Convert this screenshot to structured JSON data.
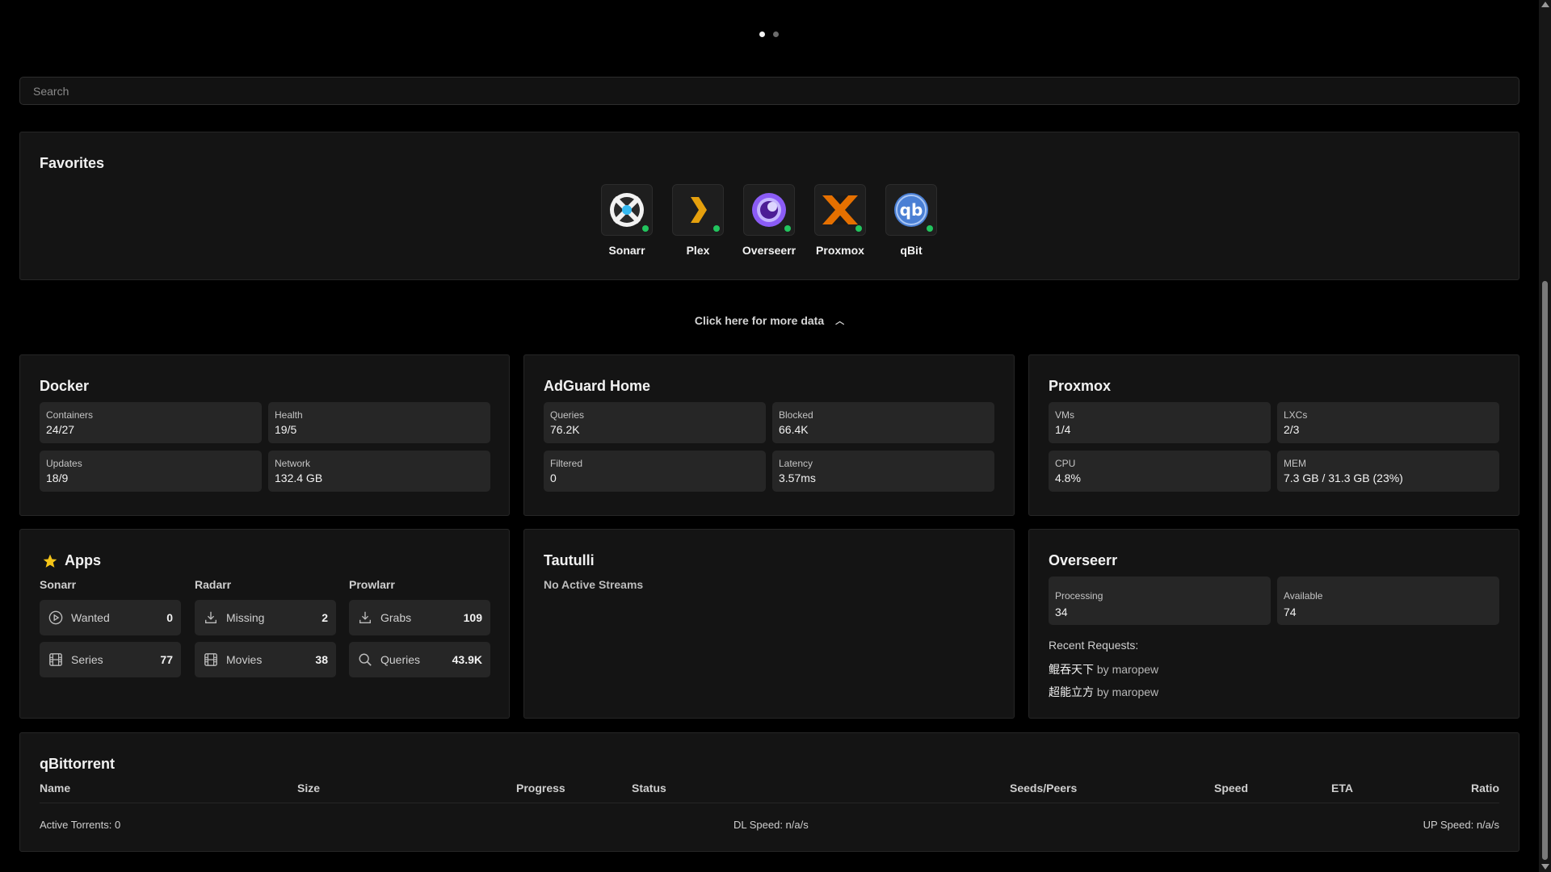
{
  "pager": {
    "active_index": 0,
    "count": 2
  },
  "search": {
    "placeholder": "Search"
  },
  "favorites": {
    "title": "Favorites",
    "items": [
      {
        "label": "Sonarr",
        "icon": "sonarr-icon",
        "status_color": "#22c55e"
      },
      {
        "label": "Plex",
        "icon": "plex-icon",
        "status_color": "#22c55e"
      },
      {
        "label": "Overseerr",
        "icon": "overseerr-icon",
        "status_color": "#22c55e"
      },
      {
        "label": "Proxmox",
        "icon": "proxmox-icon",
        "status_color": "#22c55e"
      },
      {
        "label": "qBit",
        "icon": "qbittorrent-icon",
        "status_color": "#22c55e"
      }
    ]
  },
  "more_data": {
    "label": "Click here for more data",
    "icon": "chevron-up-icon"
  },
  "docker": {
    "title": "Docker",
    "stats": [
      {
        "label": "Containers",
        "value": "24/27"
      },
      {
        "label": "Health",
        "value": "19/5"
      },
      {
        "label": "Updates",
        "value": "18/9"
      },
      {
        "label": "Network",
        "value": "132.4 GB"
      }
    ]
  },
  "adguard": {
    "title": "AdGuard Home",
    "stats": [
      {
        "label": "Queries",
        "value": "76.2K"
      },
      {
        "label": "Blocked",
        "value": "66.4K"
      },
      {
        "label": "Filtered",
        "value": "0"
      },
      {
        "label": "Latency",
        "value": "3.57ms"
      }
    ]
  },
  "proxmox": {
    "title": "Proxmox",
    "stats": [
      {
        "label": "VMs",
        "value": "1/4"
      },
      {
        "label": "LXCs",
        "value": "2/3"
      },
      {
        "label": "CPU",
        "value": "4.8%"
      },
      {
        "label": "MEM",
        "value": "7.3 GB / 31.3 GB (23%)"
      }
    ]
  },
  "apps": {
    "title": "Apps",
    "icon": "star-icon",
    "columns": [
      {
        "name": "Sonarr",
        "rows": [
          {
            "label": "Wanted",
            "value": "0",
            "icon": "play-circle-icon"
          },
          {
            "label": "Series",
            "value": "77",
            "icon": "film-icon"
          }
        ]
      },
      {
        "name": "Radarr",
        "rows": [
          {
            "label": "Missing",
            "value": "2",
            "icon": "download-icon"
          },
          {
            "label": "Movies",
            "value": "38",
            "icon": "film-icon"
          }
        ]
      },
      {
        "name": "Prowlarr",
        "rows": [
          {
            "label": "Grabs",
            "value": "109",
            "icon": "download-icon"
          },
          {
            "label": "Queries",
            "value": "43.9K",
            "icon": "search-icon"
          }
        ]
      }
    ]
  },
  "tautulli": {
    "title": "Tautulli",
    "status": "No Active Streams"
  },
  "overseerr": {
    "title": "Overseerr",
    "stats": [
      {
        "label": "Processing",
        "value": "34"
      },
      {
        "label": "Available",
        "value": "74"
      }
    ],
    "recent_title": "Recent Requests:",
    "requests": [
      {
        "title": "鲲吞天下",
        "by": "by maropew"
      },
      {
        "title": "超能立方",
        "by": "by maropew"
      }
    ]
  },
  "qbittorrent": {
    "title": "qBittorrent",
    "columns": [
      "Name",
      "Size",
      "Progress",
      "Status",
      "Seeds/Peers",
      "Speed",
      "ETA",
      "Ratio"
    ],
    "active": "Active Torrents: 0",
    "dl_speed": "DL Speed: n/a/s",
    "up_speed": "UP Speed: n/a/s"
  }
}
